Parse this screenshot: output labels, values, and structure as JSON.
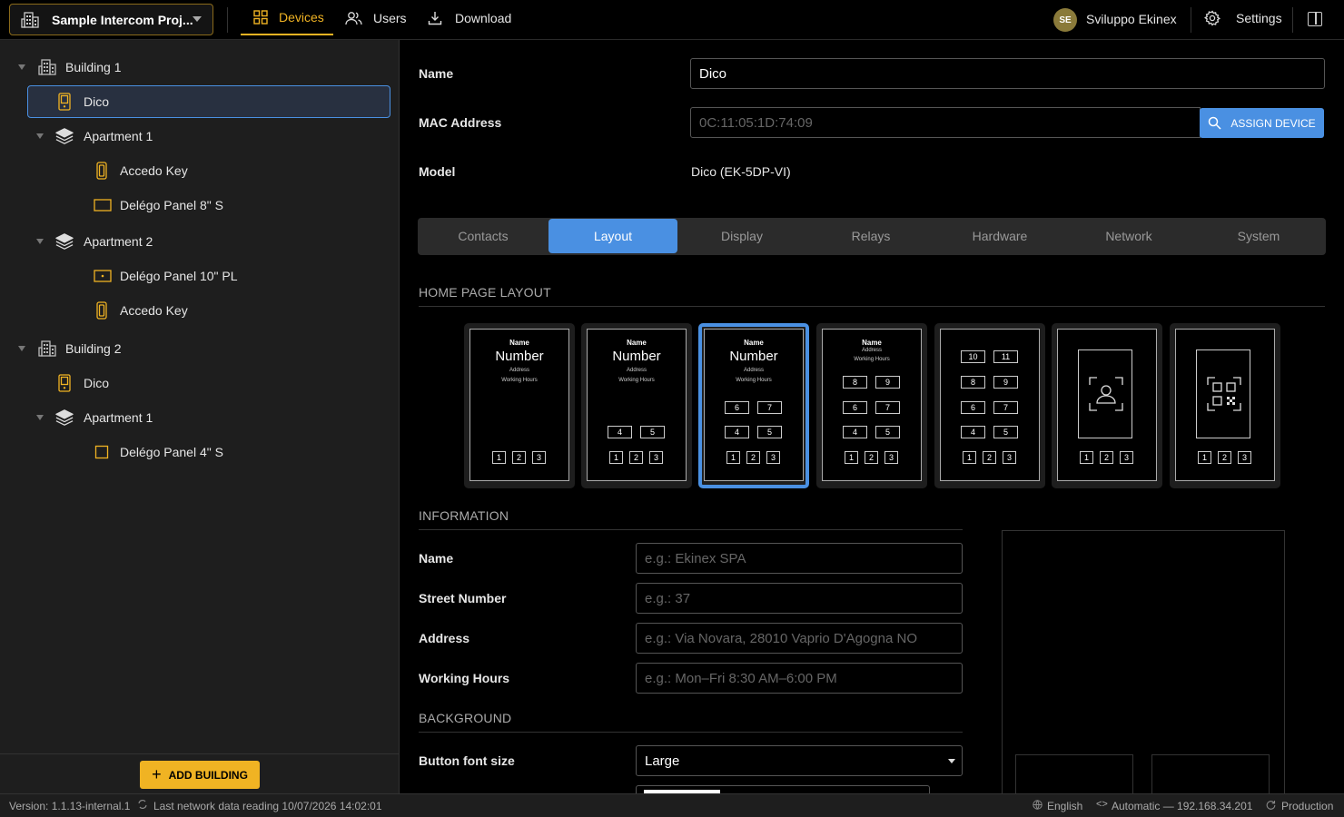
{
  "topbar": {
    "project": "Sample Intercom Proj...",
    "nav": [
      {
        "label": "Devices",
        "icon": "grid-icon",
        "active": true
      },
      {
        "label": "Users",
        "icon": "users-icon",
        "active": false
      },
      {
        "label": "Download",
        "icon": "download-icon",
        "active": false
      }
    ],
    "user_initials": "SE",
    "user_name": "Sviluppo Ekinex",
    "settings_label": "Settings"
  },
  "sidebar": {
    "tree": [
      {
        "label": "Building 1",
        "icon": "building-icon",
        "level": 0
      },
      {
        "label": "Dico",
        "icon": "doorbell-device-icon",
        "level": 1,
        "selected": true
      },
      {
        "label": "Apartment 1",
        "icon": "layers-icon",
        "level": 1
      },
      {
        "label": "Accedo Key",
        "icon": "keypad-device-icon",
        "level": 2
      },
      {
        "label": "Delégo Panel 8\" S",
        "icon": "panel-device-icon",
        "level": 2
      },
      {
        "label": "Apartment 2",
        "icon": "layers-icon",
        "level": 1
      },
      {
        "label": "Delégo Panel 10\" PL",
        "icon": "panel-device-icon",
        "level": 2
      },
      {
        "label": "Accedo Key",
        "icon": "keypad-device-icon",
        "level": 2
      },
      {
        "label": "Building 2",
        "icon": "building-icon",
        "level": 0
      },
      {
        "label": "Dico",
        "icon": "doorbell-device-icon",
        "level": 1
      },
      {
        "label": "Apartment 1",
        "icon": "layers-icon",
        "level": 1
      },
      {
        "label": "Delégo Panel 4\" S",
        "icon": "panel-device-icon",
        "level": 2
      }
    ],
    "add_building": "ADD BUILDING"
  },
  "device": {
    "name_label": "Name",
    "name_value": "Dico",
    "mac_label": "MAC Address",
    "mac_placeholder": "0C:11:05:1D:74:09",
    "assign_label": "ASSIGN DEVICE",
    "model_label": "Model",
    "model_value": "Dico (EK-5DP-VI)"
  },
  "tabs": [
    "Contacts",
    "Layout",
    "Display",
    "Relays",
    "Hardware",
    "Network",
    "System"
  ],
  "active_tab": "Layout",
  "home_layout": {
    "title": "HOME PAGE LAYOUT",
    "card_text": {
      "name": "Name",
      "number": "Number",
      "address": "Address",
      "hours": "Working Hours"
    },
    "selected_index": 2
  },
  "information": {
    "title": "INFORMATION",
    "fields": [
      {
        "label": "Name",
        "placeholder": "e.g.: Ekinex SPA"
      },
      {
        "label": "Street Number",
        "placeholder": "e.g.: 37"
      },
      {
        "label": "Address",
        "placeholder": "e.g.: Via Novara, 28010 Vaprio D'Agogna NO"
      },
      {
        "label": "Working Hours",
        "placeholder": "e.g.: Mon–Fri 8:30 AM–6:00 PM"
      }
    ]
  },
  "background": {
    "title": "BACKGROUND",
    "font_size_label": "Button font size",
    "font_size_value": "Large"
  },
  "statusbar": {
    "version": "Version: 1.1.13-internal.1",
    "last_reading": "Last network data reading 10/07/2026 14:02:01",
    "language": "English",
    "network": "Automatic — 192.168.34.201",
    "environment": "Production"
  },
  "colors": {
    "accent": "#f0b323",
    "primary": "#4a90e2",
    "sidebar": "#1e1e1e"
  }
}
